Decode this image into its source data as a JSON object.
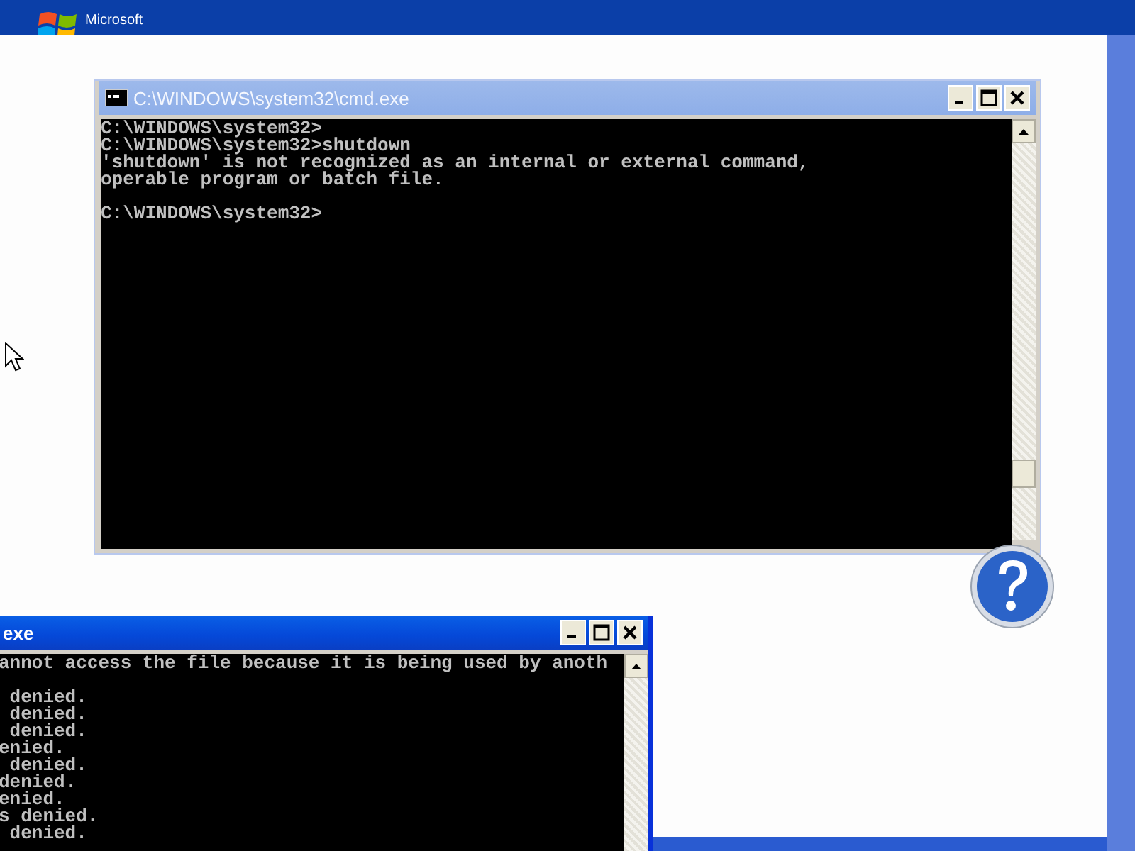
{
  "logo": {
    "text": "Microsoft"
  },
  "windows": [
    {
      "title": "C:\\WINDOWS\\system32\\cmd.exe",
      "active": false,
      "show_icon": true,
      "blocks": [
        [
          "C:\\WINDOWS\\system32>",
          "C:\\WINDOWS\\system32>shutdown",
          "'shutdown' is not recognized as an internal or external command,",
          "operable program or batch file."
        ],
        [
          "C:\\WINDOWS\\system32>"
        ]
      ]
    },
    {
      "title": "exe",
      "active": true,
      "show_icon": false,
      "blocks": [
        [
          "annot access the file because it is being used by anoth"
        ],
        [
          " denied.",
          " denied.",
          " denied.",
          "enied.",
          " denied.",
          "denied.",
          "enied.",
          "s denied.",
          " denied."
        ]
      ]
    }
  ]
}
